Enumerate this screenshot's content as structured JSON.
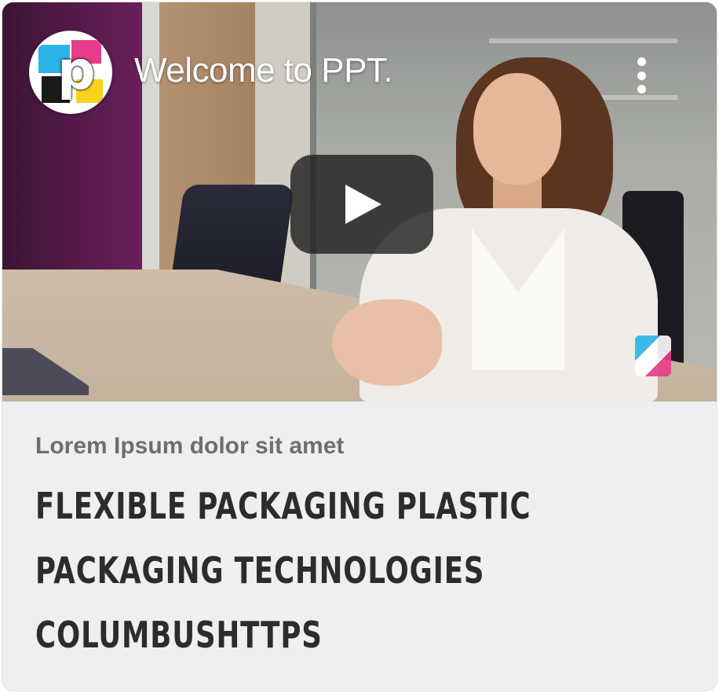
{
  "video": {
    "title": "Welcome to PPT.",
    "channel_logo_letter": "p",
    "menu_icon": "more-vert-icon",
    "play_icon": "play-icon"
  },
  "card": {
    "subtitle": "Lorem Ipsum dolor sit amet",
    "headline_lines": [
      "FLEXIBLE PACKAGING PLASTIC",
      "PACKAGING TECHNOLOGIES",
      "COLUMBUSHTTPS"
    ]
  },
  "colors": {
    "play_button_bg": "#212121",
    "card_bg": "#efefef",
    "headline": "#2c2c2c",
    "subtitle": "#6e6e6e"
  }
}
